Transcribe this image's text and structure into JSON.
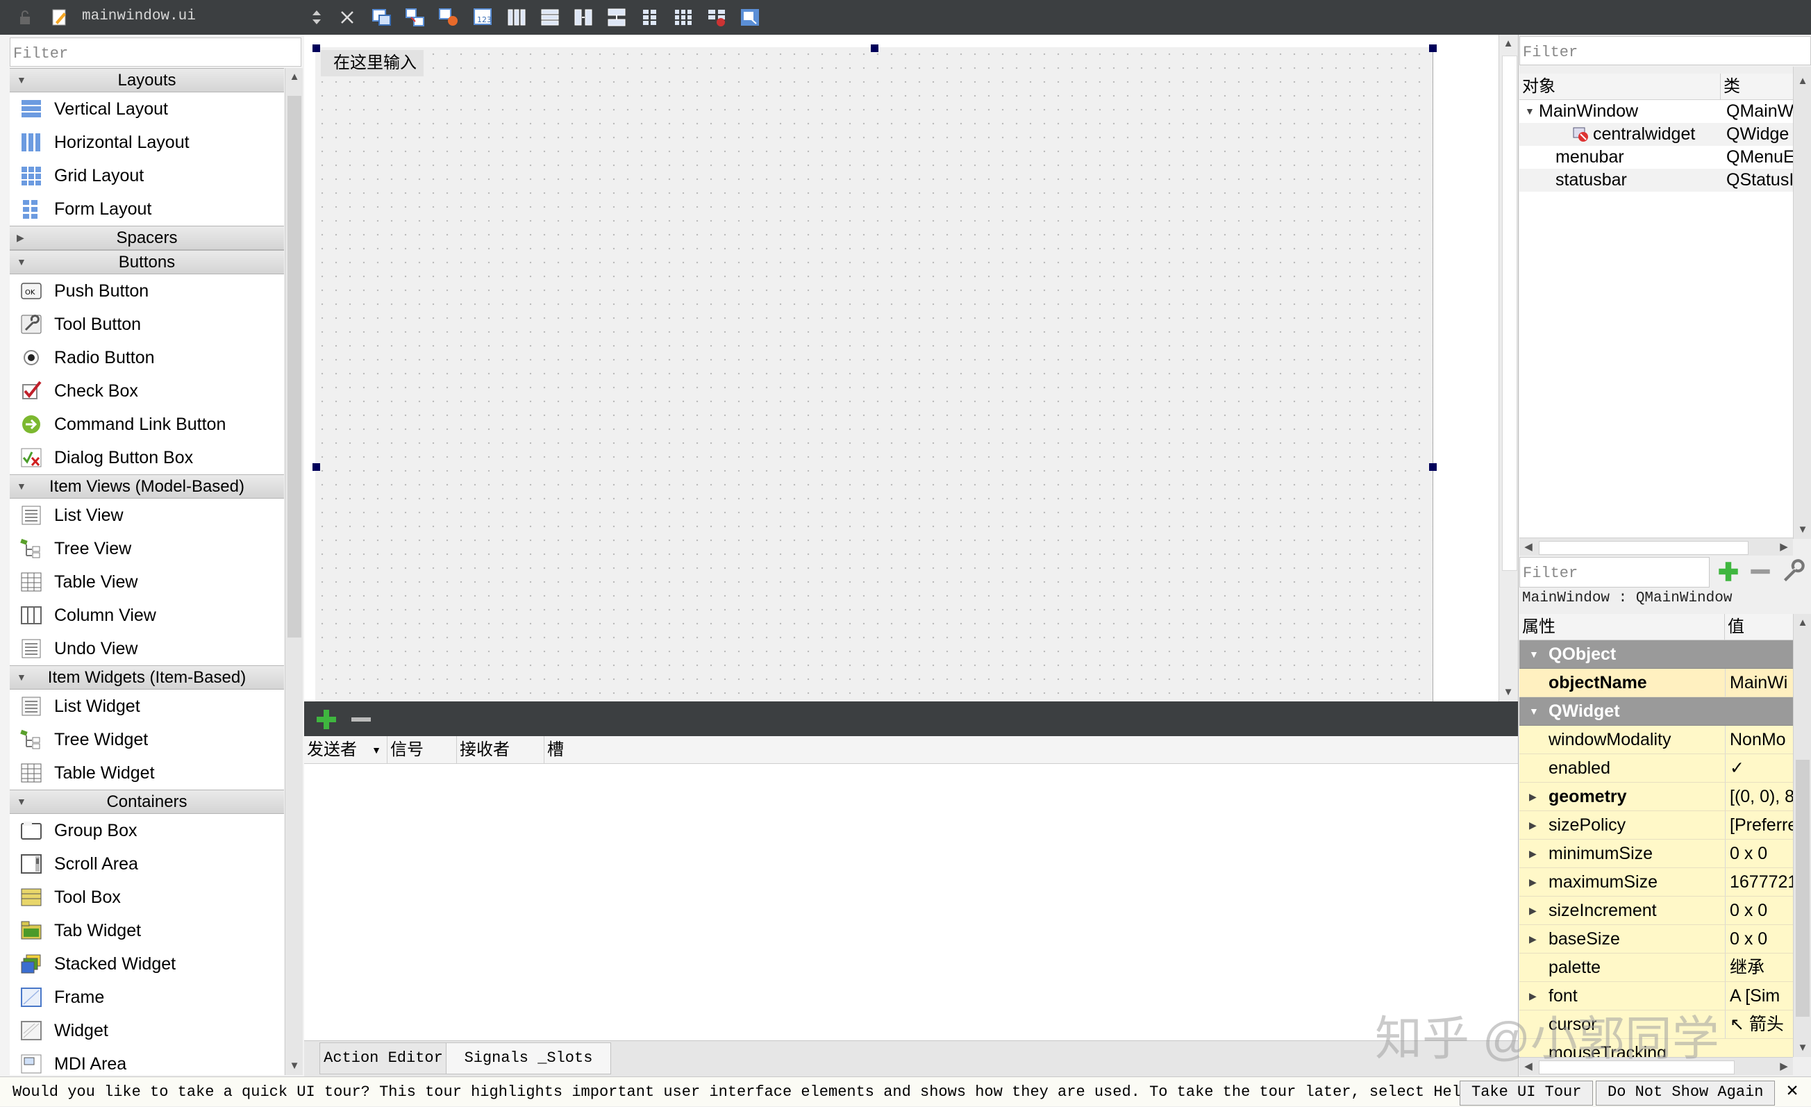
{
  "toolbar": {
    "file_name": "mainwindow.ui",
    "icons": [
      "lock-icon",
      "edit-form-icon",
      "close-icon",
      "edit-widgets-icon",
      "edit-signals-slots-icon",
      "edit-buddies-icon",
      "edit-tab-order-icon",
      "layout-horizontal-icon",
      "layout-vertical-icon",
      "layout-horizontal-splitter-icon",
      "layout-vertical-splitter-icon",
      "layout-form-icon",
      "layout-grid-icon",
      "break-layout-icon",
      "adjust-size-icon"
    ]
  },
  "widget_box": {
    "filter_placeholder": "Filter",
    "categories": [
      {
        "label": "Layouts",
        "expanded": true,
        "items": [
          {
            "label": "Vertical Layout",
            "icon": "vertical-layout-icon"
          },
          {
            "label": "Horizontal Layout",
            "icon": "horizontal-layout-icon"
          },
          {
            "label": "Grid Layout",
            "icon": "grid-layout-icon"
          },
          {
            "label": "Form Layout",
            "icon": "form-layout-icon"
          }
        ]
      },
      {
        "label": "Spacers",
        "expanded": false,
        "items": []
      },
      {
        "label": "Buttons",
        "expanded": true,
        "items": [
          {
            "label": "Push Button",
            "icon": "push-button-icon"
          },
          {
            "label": "Tool Button",
            "icon": "tool-button-icon"
          },
          {
            "label": "Radio Button",
            "icon": "radio-button-icon"
          },
          {
            "label": "Check Box",
            "icon": "check-box-icon"
          },
          {
            "label": "Command Link Button",
            "icon": "command-link-icon"
          },
          {
            "label": "Dialog Button Box",
            "icon": "dialog-button-box-icon"
          }
        ]
      },
      {
        "label": "Item Views (Model-Based)",
        "expanded": true,
        "items": [
          {
            "label": "List View",
            "icon": "list-view-icon"
          },
          {
            "label": "Tree View",
            "icon": "tree-view-icon"
          },
          {
            "label": "Table View",
            "icon": "table-view-icon"
          },
          {
            "label": "Column View",
            "icon": "column-view-icon"
          },
          {
            "label": "Undo View",
            "icon": "undo-view-icon"
          }
        ]
      },
      {
        "label": "Item Widgets (Item-Based)",
        "expanded": true,
        "items": [
          {
            "label": "List Widget",
            "icon": "list-widget-icon"
          },
          {
            "label": "Tree Widget",
            "icon": "tree-widget-icon"
          },
          {
            "label": "Table Widget",
            "icon": "table-widget-icon"
          }
        ]
      },
      {
        "label": "Containers",
        "expanded": true,
        "items": [
          {
            "label": "Group Box",
            "icon": "group-box-icon"
          },
          {
            "label": "Scroll Area",
            "icon": "scroll-area-icon"
          },
          {
            "label": "Tool Box",
            "icon": "tool-box-icon"
          },
          {
            "label": "Tab Widget",
            "icon": "tab-widget-icon"
          },
          {
            "label": "Stacked Widget",
            "icon": "stacked-widget-icon"
          },
          {
            "label": "Frame",
            "icon": "frame-icon"
          },
          {
            "label": "Widget",
            "icon": "widget-icon"
          },
          {
            "label": "MDI Area",
            "icon": "mdi-area-icon"
          }
        ]
      }
    ]
  },
  "canvas": {
    "menu_placeholder": "在这里输入"
  },
  "signal_slot_editor": {
    "columns": [
      "发送者",
      "信号",
      "接收者",
      "槽"
    ],
    "tabs": [
      "Action Editor",
      "Signals _Slots Ed…"
    ]
  },
  "object_inspector": {
    "filter_placeholder": "Filter",
    "col_object": "对象",
    "col_class": "类",
    "rows": [
      {
        "name": "MainWindow",
        "class": "QMainW",
        "indent": 0,
        "expander": true
      },
      {
        "name": "centralwidget",
        "class": "QWidge",
        "indent": 2,
        "icon": "widget-layout-broken-icon"
      },
      {
        "name": "menubar",
        "class": "QMenuE",
        "indent": 1
      },
      {
        "name": "statusbar",
        "class": "QStatusI",
        "indent": 1
      }
    ]
  },
  "property_editor": {
    "filter_placeholder": "Filter",
    "class_label": "MainWindow : QMainWindow",
    "col_property": "属性",
    "col_value": "值",
    "rows": [
      {
        "type": "group",
        "name": "QObject"
      },
      {
        "type": "prop",
        "name": "objectName",
        "value": "MainWi",
        "bold": true,
        "sel": true
      },
      {
        "type": "group",
        "name": "QWidget"
      },
      {
        "type": "prop",
        "name": "windowModality",
        "value": "NonMo"
      },
      {
        "type": "prop",
        "name": "enabled",
        "value": "✓"
      },
      {
        "type": "prop",
        "name": "geometry",
        "value": "[(0, 0), 8",
        "bold": true,
        "expander": true
      },
      {
        "type": "prop",
        "name": "sizePolicy",
        "value": "[Preferre",
        "expander": true
      },
      {
        "type": "prop",
        "name": "minimumSize",
        "value": "0 x 0",
        "expander": true
      },
      {
        "type": "prop",
        "name": "maximumSize",
        "value": "1677721",
        "expander": true
      },
      {
        "type": "prop",
        "name": "sizeIncrement",
        "value": "0 x 0",
        "expander": true
      },
      {
        "type": "prop",
        "name": "baseSize",
        "value": "0 x 0",
        "expander": true
      },
      {
        "type": "prop",
        "name": "palette",
        "value": "继承"
      },
      {
        "type": "prop",
        "name": "font",
        "value": "A  [Sim",
        "expander": true
      },
      {
        "type": "prop",
        "name": "cursor",
        "value": "↖ 箭头"
      },
      {
        "type": "prop",
        "name": "mouseTracking",
        "value": ""
      }
    ]
  },
  "tour": {
    "message": "Would you like to take a quick UI tour? This tour highlights important user interface elements and shows how they are used. To take the tour later, select Help > UI Tour.",
    "take_label": "Take UI Tour",
    "dismiss_label": "Do Not Show Again",
    "close_label": "✕"
  },
  "watermark": "知乎 @小郭同学"
}
